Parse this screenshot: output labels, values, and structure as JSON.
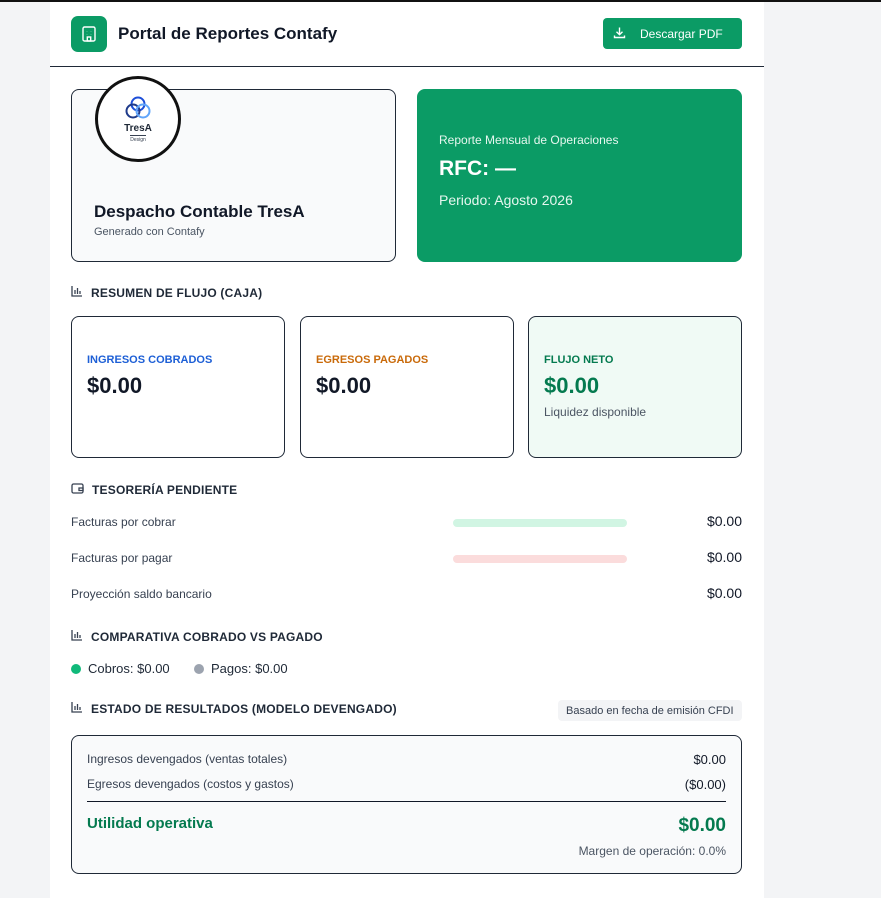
{
  "header": {
    "app_title": "Portal de Reportes Contafy",
    "download_label": "Descargar PDF"
  },
  "company": {
    "logo_brand": "TresA",
    "logo_sub": "Design",
    "name": "Despacho Contable TresA",
    "generated_with": "Generado con Contafy"
  },
  "report": {
    "title": "Reporte Mensual de Operaciones",
    "rfc": "RFC: —",
    "period": "Periodo: Agosto 2026"
  },
  "cashflow": {
    "section_title": "RESUMEN DE FLUJO (CAJA)",
    "income_label": "INGRESOS COBRADOS",
    "income_value": "$0.00",
    "expense_label": "EGRESOS PAGADOS",
    "expense_value": "$0.00",
    "net_label": "FLUJO NETO",
    "net_value": "$0.00",
    "net_note": "Liquidez disponible"
  },
  "treasury": {
    "section_title": "TESORERÍA PENDIENTE",
    "receivable_label": "Facturas por cobrar",
    "receivable_value": "$0.00",
    "payable_label": "Facturas por pagar",
    "payable_value": "$0.00",
    "projection_label": "Proyección saldo bancario",
    "projection_value": "$0.00"
  },
  "comparison": {
    "section_title": "COMPARATIVA COBRADO VS PAGADO",
    "collections": "Cobros: $0.00",
    "payments": "Pagos: $0.00"
  },
  "income_statement": {
    "section_title": "ESTADO DE RESULTADOS (MODELO DEVENGADO)",
    "basis_tag": "Basado en fecha de emisión CFDI",
    "accrued_income_label": "Ingresos devengados (ventas totales)",
    "accrued_income_value": "$0.00",
    "accrued_expense_label": "Egresos devengados (costos y gastos)",
    "accrued_expense_value": "($0.00)",
    "operating_profit_label": "Utilidad operativa",
    "operating_profit_value": "$0.00",
    "operating_margin": "Margen de operación: 0.0%"
  },
  "colors": {
    "brand_green": "#0b9b65",
    "income_blue": "#1d5fd6",
    "expense_orange": "#c96a0a",
    "net_green": "#047a4f",
    "receivable_bar": "#d1f5e3",
    "payable_bar": "#fbdcdc",
    "collections_dot": "#10b97a",
    "payments_dot": "#9ca3af"
  },
  "icons": {
    "header_logo": "building-icon",
    "download": "download-icon",
    "section_flow": "bar-chart-icon",
    "section_treasury": "wallet-icon",
    "section_comparison": "bar-chart-icon",
    "section_results": "bar-chart-icon"
  }
}
